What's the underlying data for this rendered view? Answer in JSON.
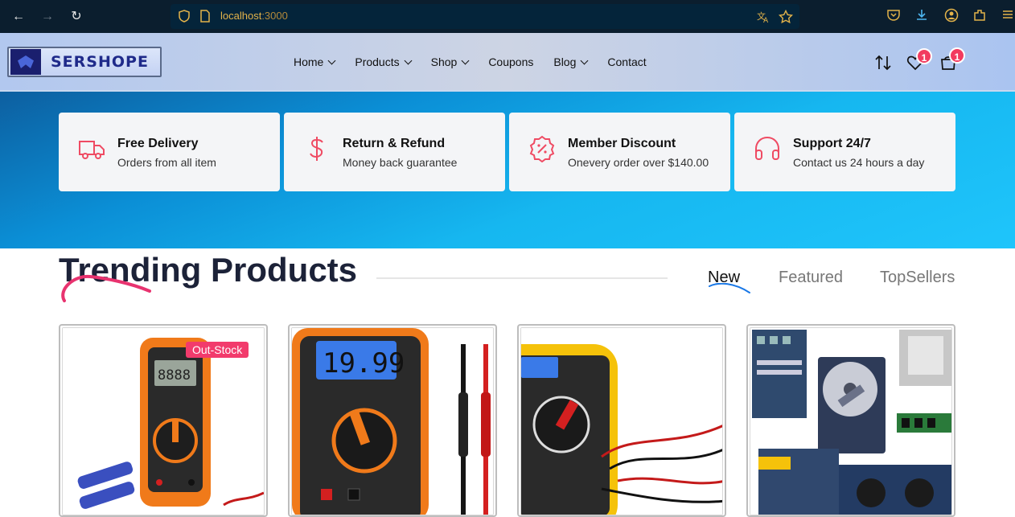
{
  "browser": {
    "url_host": "localhost",
    "url_port": ":3000"
  },
  "header": {
    "logo_text": "SERSHOPE",
    "menu": [
      {
        "label": "Home",
        "dropdown": true
      },
      {
        "label": "Products",
        "dropdown": true
      },
      {
        "label": "Shop",
        "dropdown": true
      },
      {
        "label": "Coupons",
        "dropdown": false
      },
      {
        "label": "Blog",
        "dropdown": true
      },
      {
        "label": "Contact",
        "dropdown": false
      }
    ],
    "wishlist_count": "1",
    "cart_count": "1"
  },
  "features": [
    {
      "icon": "truck-icon",
      "title": "Free Delivery",
      "subtitle": "Orders from all item"
    },
    {
      "icon": "dollar-icon",
      "title": "Return & Refund",
      "subtitle": "Money back guarantee"
    },
    {
      "icon": "discount-badge-icon",
      "title": "Member Discount",
      "subtitle": "Onevery order over $140.00"
    },
    {
      "icon": "headphones-icon",
      "title": "Support 24/7",
      "subtitle": "Contact us 24 hours a day"
    }
  ],
  "trending": {
    "title": "Trending Products",
    "tabs": [
      {
        "label": "New",
        "active": true
      },
      {
        "label": "Featured",
        "active": false
      },
      {
        "label": "TopSellers",
        "active": false
      }
    ],
    "products": [
      {
        "image": "multimeter-orange-image",
        "badge": "Out-Stock"
      },
      {
        "image": "multimeter-blue-display-image",
        "badge": ""
      },
      {
        "image": "multimeter-yellow-image",
        "badge": ""
      },
      {
        "image": "computer-parts-image",
        "badge": ""
      }
    ]
  },
  "colors": {
    "accent": "#f23b5f",
    "hero_start": "#0d5fa0",
    "hero_end": "#1fc5fb",
    "feature_icon": "#ef4b63"
  }
}
